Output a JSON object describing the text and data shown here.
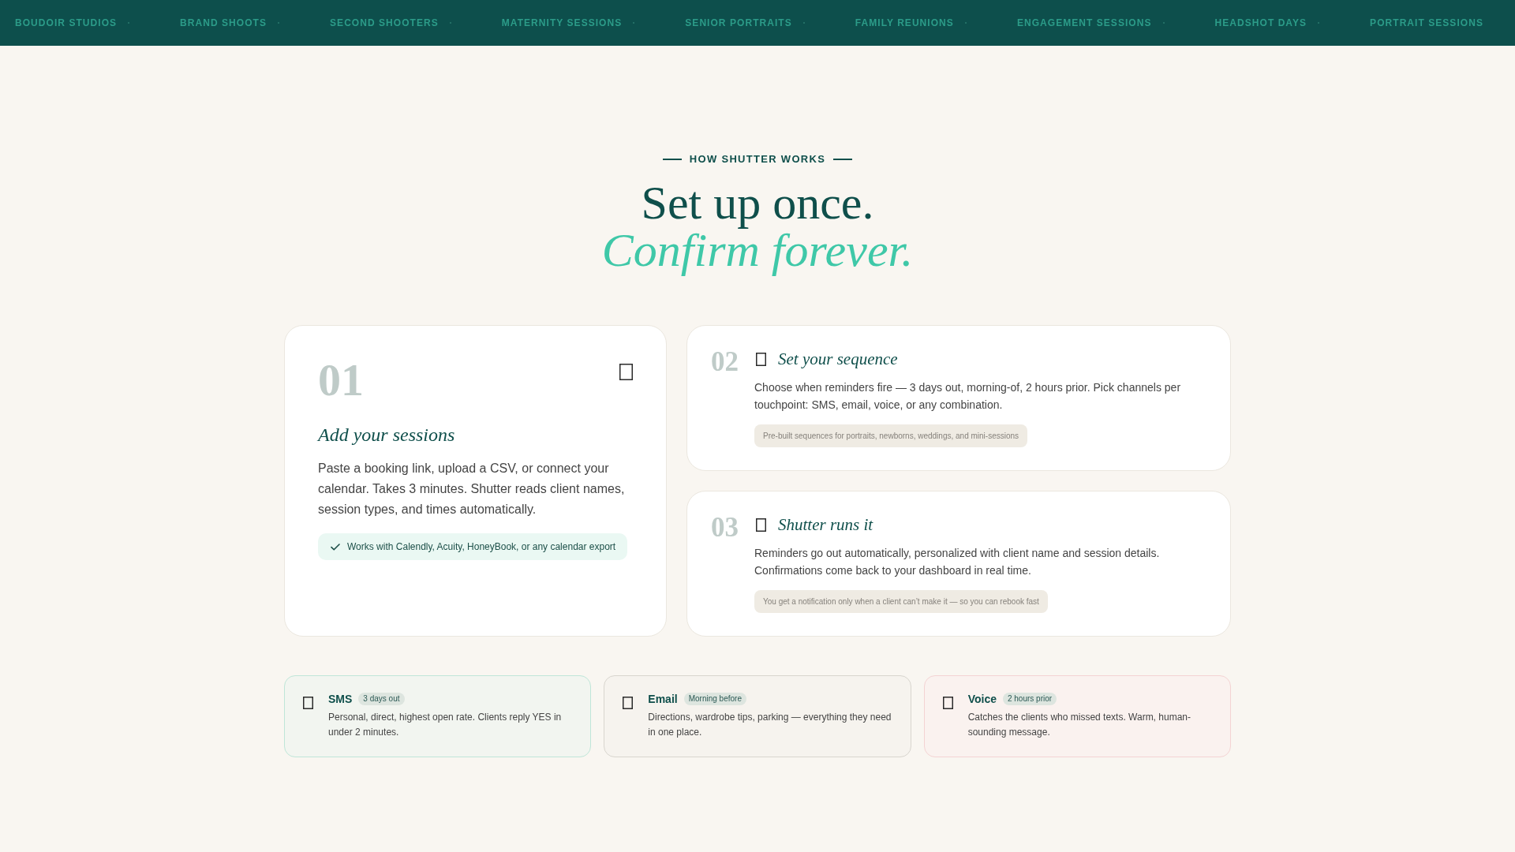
{
  "nav": {
    "items": [
      "BOUDOIR STUDIOS",
      "BRAND SHOOTS",
      "SECOND SHOOTERS",
      "MATERNITY SESSIONS",
      "SENIOR PORTRAITS",
      "FAMILY REUNIONS",
      "ENGAGEMENT SESSIONS",
      "HEADSHOT DAYS",
      "PORTRAIT SESSIONS"
    ]
  },
  "section": {
    "eyebrow": "HOW SHUTTER WORKS",
    "title": "Set up once.",
    "title_accent": "Confirm forever."
  },
  "steps": [
    {
      "kind": "featured",
      "number": "01",
      "title": "Add your sessions",
      "body": "Paste a booking link, upload a CSV, or connect your calendar. Takes 3 minutes. Shutter reads client names, session types, and times automatically.",
      "note": "Works with Calendly, Acuity, HoneyBook, or any calendar export"
    },
    {
      "kind": "compact",
      "number": "02",
      "title": "Set your sequence",
      "body": "Choose when reminders fire — 3 days out, morning-of, 2 hours prior. Pick channels per touchpoint: SMS, email, voice, or any combination.",
      "note": "Pre-built sequences for portraits, newborns, weddings, and mini-sessions"
    },
    {
      "kind": "compact",
      "number": "03",
      "title": "Shutter runs it",
      "body": "Reminders go out automatically, personalized with client name and session details. Confirmations come back to your dashboard in real time.",
      "note": "You get a notification only when a client can’t make it — so you can rebook fast"
    }
  ],
  "channels": [
    {
      "name": "SMS",
      "timing": "3 days out",
      "description": "Personal, direct, highest open rate. Clients reply YES in under 2 minutes.",
      "color": "#bfe6d8"
    },
    {
      "name": "Email",
      "timing": "Morning before",
      "description": "Directions, wardrobe tips, parking — everything they need in one place.",
      "color": "#d8d5ce"
    },
    {
      "name": "Voice",
      "timing": "2 hours prior",
      "description": "Catches the clients who missed texts. Warm, human-sounding message.",
      "color": "#f4d3d3"
    }
  ]
}
